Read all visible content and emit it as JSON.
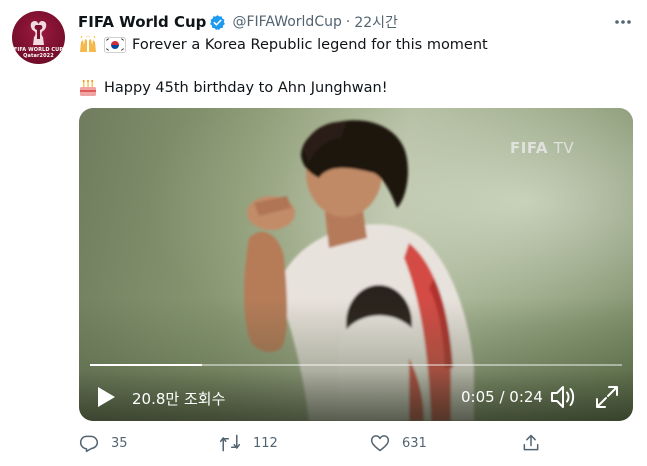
{
  "account": {
    "name": "FIFA World Cup",
    "handle": "@FIFAWorldCup",
    "separator": "·",
    "time": "22시간",
    "avatar_caption_line1": "FIFA WORLD CUP",
    "avatar_caption_line2": "Qatar2022",
    "verified_icon": "verified-badge-icon",
    "verified_color": "#1d9bf0"
  },
  "tweet": {
    "line1_emoji": [
      "raising-hands-emoji",
      "korea-flag-emoji"
    ],
    "line1_text": "Forever a Korea Republic legend for this moment",
    "line2_emoji": "birthday-cake-emoji",
    "line2_text": "Happy 45th birthday to Ahn Junghwan!"
  },
  "video": {
    "watermark_bold": "FIFA",
    "watermark_light": "TV",
    "views": "20.8만 조회수",
    "timecode": "0:05 / 0:24",
    "progress_fraction": 0.21
  },
  "actions": {
    "replies": "35",
    "retweets": "112",
    "likes": "631"
  },
  "colors": {
    "text_primary": "#0f1419",
    "text_secondary": "#536471"
  }
}
